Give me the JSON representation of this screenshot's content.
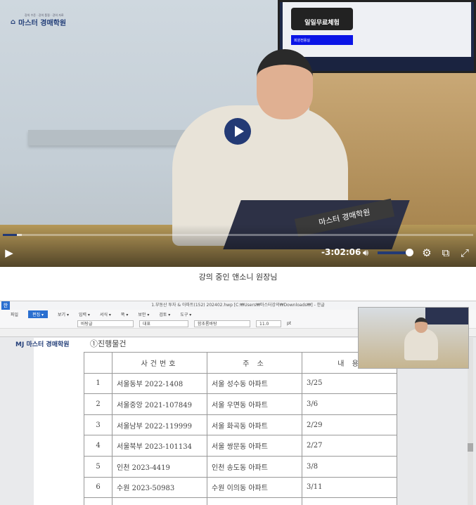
{
  "video": {
    "logo_text": "마스터 경매학원",
    "logo_tagline": "강의 수준 · 강의 품질 · 강의 자료",
    "monitor_banner": "일일무료체험",
    "monitor_blue_box": "회원전용실",
    "sign_text": "마스터 경매학원",
    "controls": {
      "remaining_time": "-3:02:06",
      "progress_percent": 3,
      "volume_percent": 100
    }
  },
  "caption": "강의 중인 앤소니 원장님",
  "document": {
    "window_title": "1.부동산 투자 & 아파트(152)  202402.hwp [C:₩Users₩마스터강의₩Downloads₩] - 한글",
    "app_icon": "한",
    "menu": [
      "파일",
      "편집 ▾",
      "보기 ▾",
      "입력 ▾",
      "서식 ▾",
      "쪽 ▾",
      "보안 ▾",
      "검토 ▾",
      "도구 ▾"
    ],
    "toolbar": {
      "style": "바탕글",
      "lang": "대표",
      "font": "함초롬바탕",
      "size": "11.0",
      "unit": "pt"
    },
    "overlay_logo": "MJ 마스터 경매학원",
    "section_title": "①진행물건",
    "table": {
      "headers": [
        "",
        "사건번호",
        "주    소",
        "내    용"
      ],
      "rows": [
        [
          "1",
          "서울동부 2022-1408",
          "서울 성수동 아파트",
          "3/25"
        ],
        [
          "2",
          "서울중앙 2021-107849",
          "서울 우면동 아파트",
          "3/6"
        ],
        [
          "3",
          "서울남부 2022-119999",
          "서울 화곡동 아파트",
          "2/29"
        ],
        [
          "4",
          "서울북부 2023-101134",
          "서울 쌍문동 아파트",
          "2/27"
        ],
        [
          "5",
          "인천 2023-4419",
          "인천 송도동 아파트",
          "3/8"
        ],
        [
          "6",
          "수원 2023-50983",
          "수원 이의동 아파트",
          "3/11"
        ]
      ]
    }
  }
}
